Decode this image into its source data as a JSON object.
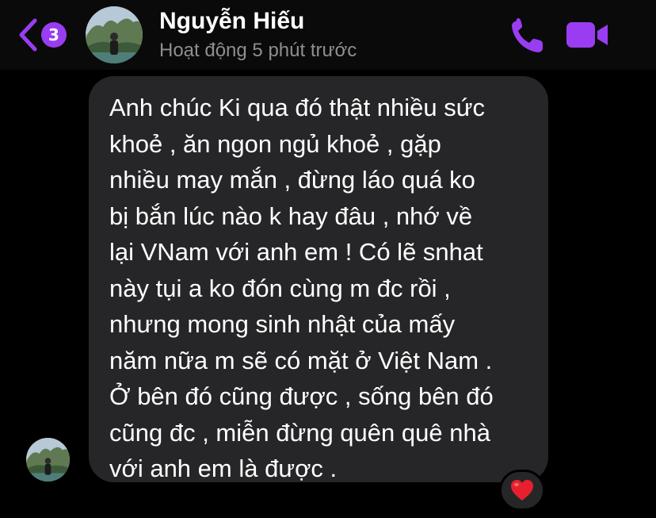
{
  "header": {
    "back_count": "3",
    "contact_name": "Nguyễn Hiếu",
    "status": "Hoạt động 5 phút trước"
  },
  "icons": {
    "back": "chevron-left-icon",
    "call": "phone-icon",
    "video": "video-camera-icon",
    "reaction": "heart-icon"
  },
  "colors": {
    "accent": "#9a3df2",
    "bubble": "#262628",
    "status_text": "#8e8e93",
    "heart": "#e8202e"
  },
  "message": {
    "lines": [
      "Anh chúc Ki qua đó thật nhiều sức",
      "khoẻ , ăn ngon ngủ khoẻ , gặp",
      "nhiều may mắn , đừng láo quá ko",
      "bị bắn lúc nào k hay đâu , nhớ về",
      "lại VNam với anh em ! Có lẽ snhat",
      "này tụi a ko đón cùng m đc rồi ,",
      "nhưng mong sinh nhật của mấy",
      "năm nữa m sẽ có mặt ở Việt Nam .",
      "Ở bên đó cũng được , sống bên đó",
      "cũng đc , miễn đừng quên quê nhà",
      "với anh em là được ."
    ]
  }
}
